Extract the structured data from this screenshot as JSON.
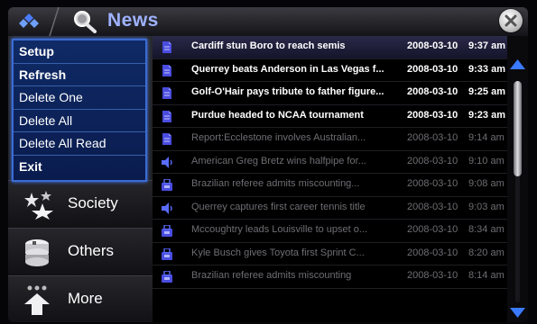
{
  "app": {
    "title": "News"
  },
  "titlebar": {
    "logo_icon": "diamond-logo-icon",
    "search_icon": "magnifier-icon",
    "close_icon": "close-icon"
  },
  "menu": {
    "items": [
      {
        "label": "Setup",
        "bold": true
      },
      {
        "label": "Refresh",
        "bold": true
      },
      {
        "label": "Delete One",
        "bold": false
      },
      {
        "label": "Delete All",
        "bold": false
      },
      {
        "label": "Delete All Read",
        "bold": false
      },
      {
        "label": "Exit",
        "bold": true
      }
    ]
  },
  "categories": [
    {
      "label": "Society",
      "icon": "star-cluster-icon"
    },
    {
      "label": "Others",
      "icon": "stack-icon"
    },
    {
      "label": "More",
      "icon": "up-arrow-icon"
    }
  ],
  "news": [
    {
      "title": "Cardiff stun Boro to reach semis",
      "date": "2008-03-10",
      "time": "9:37 am",
      "state": "unread",
      "icon": "document-icon",
      "highlight": true
    },
    {
      "title": "Querrey beats Anderson in Las Vegas f...",
      "date": "2008-03-10",
      "time": "9:33 am",
      "state": "unread",
      "icon": "document-icon"
    },
    {
      "title": "Golf-O'Hair pays tribute to father figure...",
      "date": "2008-03-10",
      "time": "9:25 am",
      "state": "unread",
      "icon": "document-icon"
    },
    {
      "title": "Purdue headed to NCAA tournament",
      "date": "2008-03-10",
      "time": "9:23 am",
      "state": "unread",
      "icon": "document-icon"
    },
    {
      "title": "Report:Ecclestone involves Australian...",
      "date": "2008-03-10",
      "time": "9:14 am",
      "state": "read",
      "icon": "document-icon"
    },
    {
      "title": "American Greg Bretz wins halfpipe for...",
      "date": "2008-03-10",
      "time": "9:10 am",
      "state": "read",
      "icon": "speaker-icon"
    },
    {
      "title": "Brazilian referee admits miscounting...",
      "date": "2008-03-10",
      "time": "9:08 am",
      "state": "read",
      "icon": "headset-icon"
    },
    {
      "title": "Querrey captures first career tennis title",
      "date": "2008-03-10",
      "time": "9:03 am",
      "state": "read",
      "icon": "speaker-icon"
    },
    {
      "title": "Mccoughtry leads Louisville to upset o...",
      "date": "2008-03-10",
      "time": "8:34 am",
      "state": "read",
      "icon": "headset-icon"
    },
    {
      "title": "Kyle Busch gives Toyota first Sprint C...",
      "date": "2008-03-10",
      "time": "8:20 am",
      "state": "read",
      "icon": "headset-icon"
    },
    {
      "title": "Brazilian referee admits miscounting",
      "date": "2008-03-10",
      "time": "8:14 am",
      "state": "read",
      "icon": "headset-icon"
    }
  ],
  "scroll": {
    "position": 0
  },
  "colors": {
    "accent": "#3a6cd4",
    "title": "#9fb2ff",
    "icon": "#5a6cff"
  }
}
